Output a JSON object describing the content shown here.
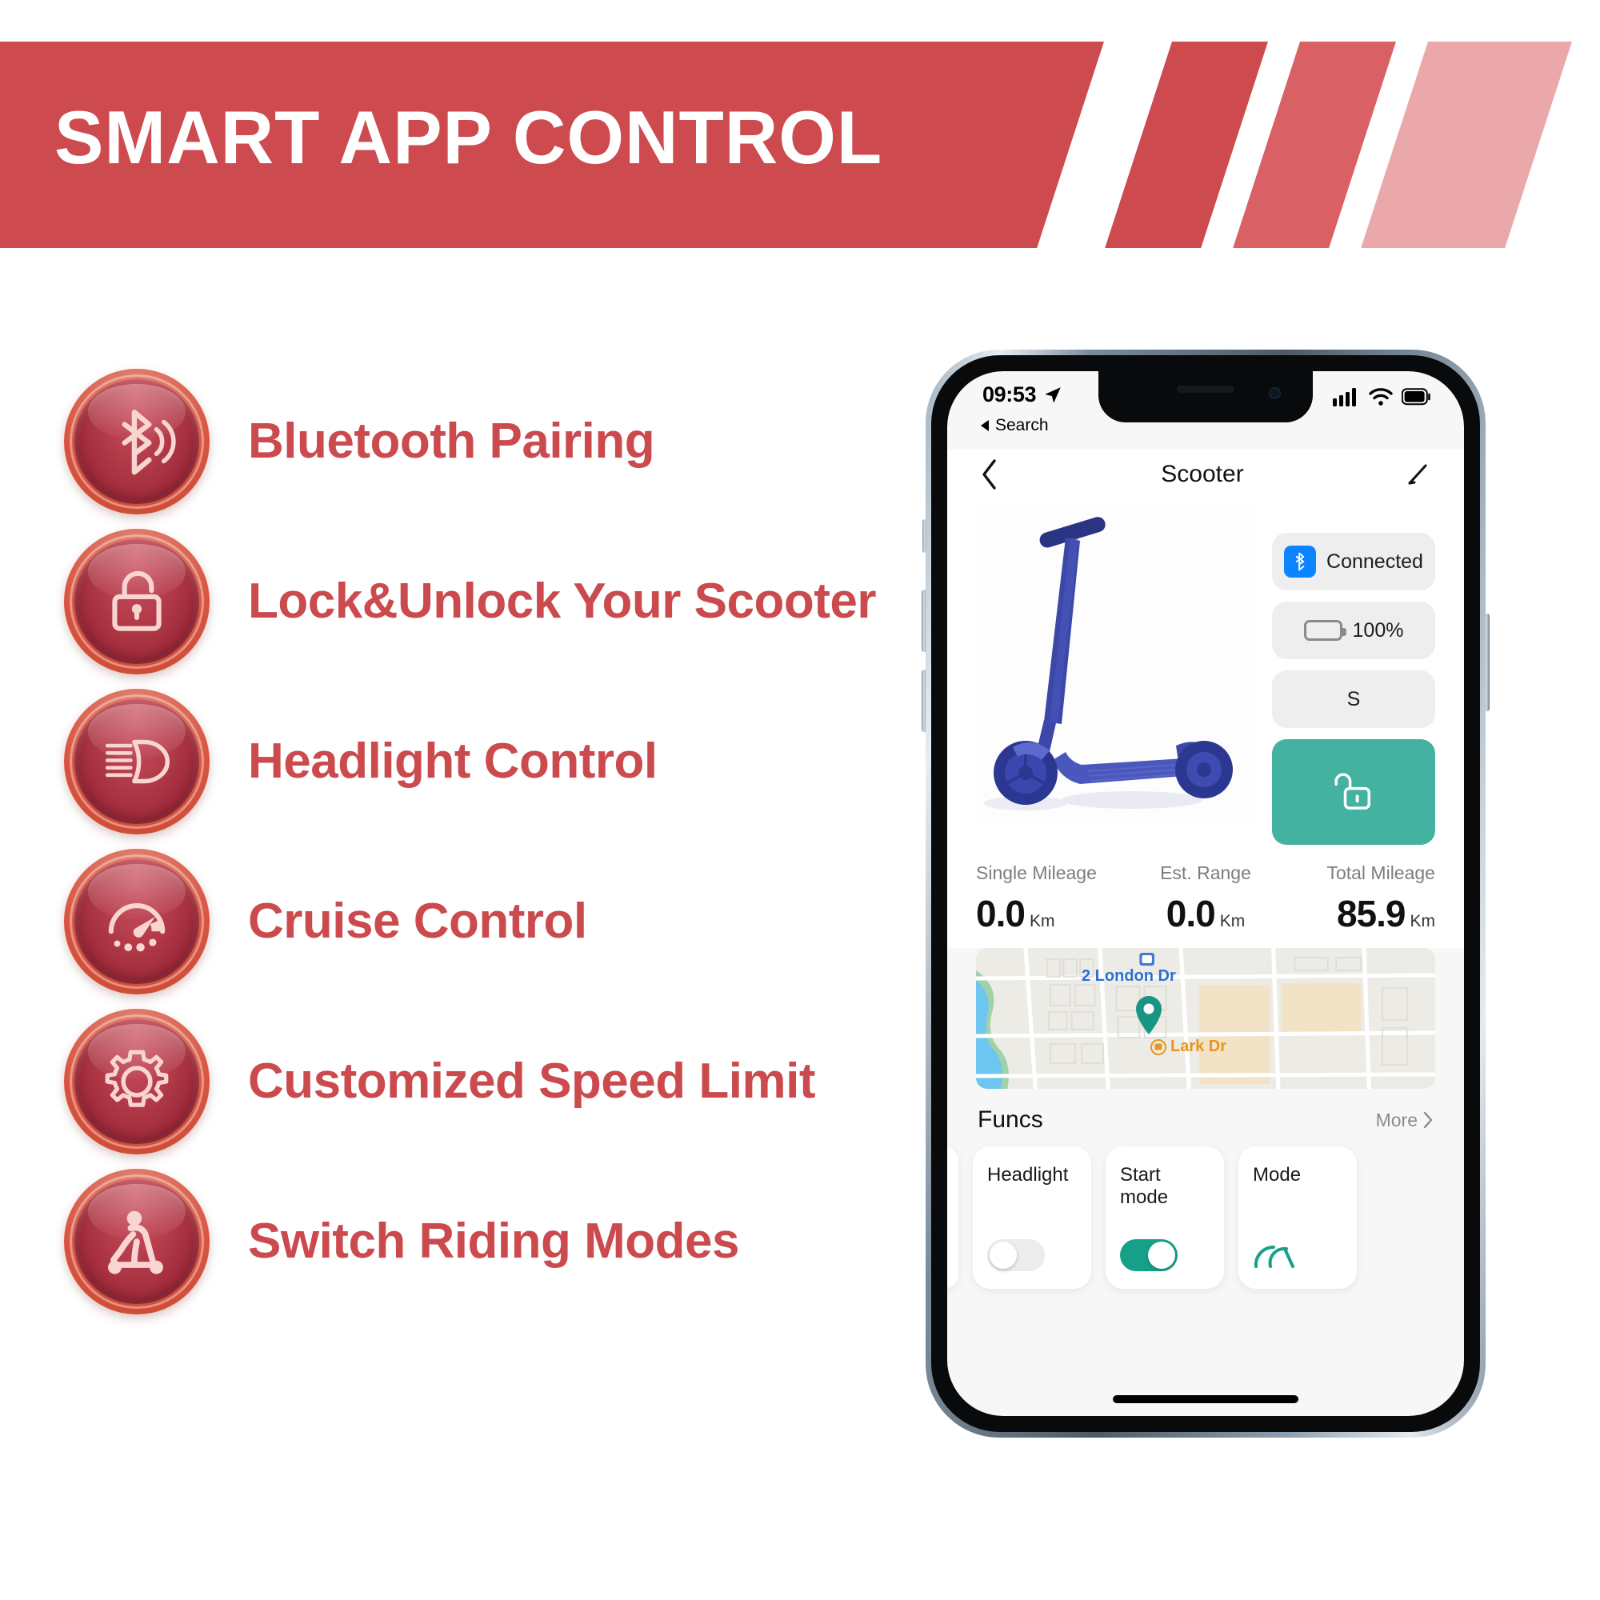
{
  "banner": {
    "title": "SMART APP CONTROL",
    "accent_color": "#cd4a4e",
    "stripe_color_faded": "#eaa8ab"
  },
  "features": [
    {
      "icon": "bluetooth-icon",
      "label": "Bluetooth Pairing"
    },
    {
      "icon": "unlock-padlock-icon",
      "label": "Lock&Unlock Your Scooter"
    },
    {
      "icon": "headlight-beam-icon",
      "label": "Headlight Control"
    },
    {
      "icon": "speedometer-icon",
      "label": "Cruise Control"
    },
    {
      "icon": "gear-icon",
      "label": "Customized Speed Limit"
    },
    {
      "icon": "scooter-rider-icon",
      "label": "Switch Riding Modes"
    }
  ],
  "phone": {
    "status_bar": {
      "time": "09:53",
      "location_icon": "location-arrow-icon",
      "back_to_app": "Search",
      "signal_icon": "cellular-bars-icon",
      "wifi_icon": "wifi-icon",
      "battery_icon": "battery-icon"
    },
    "nav": {
      "back_icon": "chevron-left-icon",
      "title": "Scooter",
      "edit_icon": "pencil-icon"
    },
    "hero": {
      "product_image": "blue-electric-scooter-illustration",
      "controls": {
        "bluetooth_status": "Connected",
        "bluetooth_icon": "bluetooth-icon",
        "battery_percent": "100%",
        "battery_icon": "battery-full-icon",
        "mode_chip": "S",
        "unlock_icon": "unlock-padlock-icon",
        "unlock_color": "#43b2a1"
      }
    },
    "stats": [
      {
        "label": "Single Mileage",
        "value": "0.0",
        "unit": "Km"
      },
      {
        "label": "Est. Range",
        "value": "0.0",
        "unit": "Km"
      },
      {
        "label": "Total Mileage",
        "value": "85.9",
        "unit": "Km"
      }
    ],
    "map": {
      "street_label_1": "2 London Dr",
      "street_label_2": "Lark Dr",
      "pin_icon": "map-pin-icon",
      "pin_color": "#1a9484"
    },
    "funcs": {
      "title": "Funcs",
      "more_label": "More",
      "more_icon": "chevron-right-icon",
      "cards": [
        {
          "label": "Headlight",
          "control": "toggle",
          "state": "off"
        },
        {
          "label": "Start mode",
          "control": "toggle",
          "state": "on"
        },
        {
          "label": "Mode",
          "control": "icon",
          "icon": "speedometer-icon"
        }
      ]
    }
  }
}
